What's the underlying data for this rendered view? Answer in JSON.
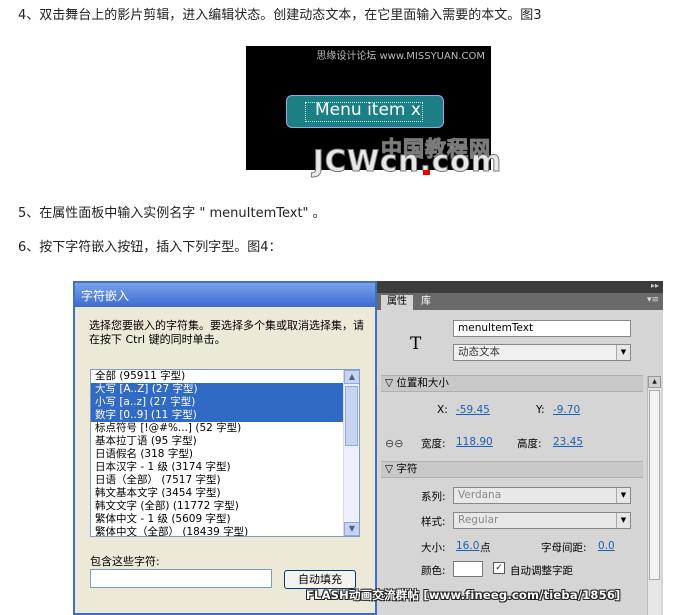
{
  "steps": {
    "step4": "4、双击舞台上的影片剪辑，进入编辑状态。创建动态文本，在它里面输入需要的本文。图3",
    "step5": "5、在属性面板中输入实例名字 \" menuItemText\" 。",
    "step6": "6、按下字符嵌入按钮，插入下列字型。图4："
  },
  "figure3": {
    "site_text": "思缘设计论坛 www.MISSYUAN.COM",
    "menu_text": "Menu item x",
    "watermark_cn": "中国教程网",
    "watermark_en": "JCWcn.com"
  },
  "dialog": {
    "title": "字符嵌入",
    "description": "选择您要嵌入的字符集。要选择多个集或取消选择集，请在按下 Ctrl 键的同时单击。",
    "items": [
      {
        "label": "全部 (95911 字型)",
        "selected": false
      },
      {
        "label": "大写 [A..Z] (27 字型)",
        "selected": true
      },
      {
        "label": "小写 [a..z] (27 字型)",
        "selected": true
      },
      {
        "label": "数字 [0..9] (11 字型)",
        "selected": true
      },
      {
        "label": "标点符号 [!@#%...] (52 字型)",
        "selected": false
      },
      {
        "label": "基本拉丁语 (95 字型)",
        "selected": false
      },
      {
        "label": "日语假名 (318 字型)",
        "selected": false
      },
      {
        "label": "日本汉字 - 1 级 (3174 字型)",
        "selected": false
      },
      {
        "label": "日语（全部） (7517 字型)",
        "selected": false
      },
      {
        "label": "韩文基本文字 (3454 字型)",
        "selected": false
      },
      {
        "label": "韩文文字 (全部) (11772 字型)",
        "selected": false
      },
      {
        "label": "繁体中文 - 1 级 (5609 字型)",
        "selected": false
      },
      {
        "label": "繁体中文（全部） (18439 字型)",
        "selected": false
      }
    ],
    "include_label": "包含这些字符:",
    "include_value": "",
    "autofill_button": "自动填充"
  },
  "panel": {
    "tab_properties": "属性",
    "tab_library": "库",
    "instance_name": "menuItemText",
    "text_type": "动态文本",
    "section_position": "位置和大小",
    "x_label": "X:",
    "x_value": "-59.45",
    "y_label": "Y:",
    "y_value": "-9.70",
    "width_label": "宽度:",
    "width_value": "118.90",
    "height_label": "高度:",
    "height_value": "23.45",
    "section_char": "字符",
    "family_label": "系列:",
    "family_value": "Verdana",
    "style_label": "样式:",
    "style_value": "Regular",
    "size_label": "大小:",
    "size_value": "16.0",
    "size_unit": "点",
    "spacing_label": "字母间距:",
    "spacing_value": "0.0",
    "color_label": "颜色:",
    "auto_kern_label": "自动调整字距"
  },
  "footer": "FLASH动画交流群帖 [www.fineeg.com/tieba/1856]"
}
